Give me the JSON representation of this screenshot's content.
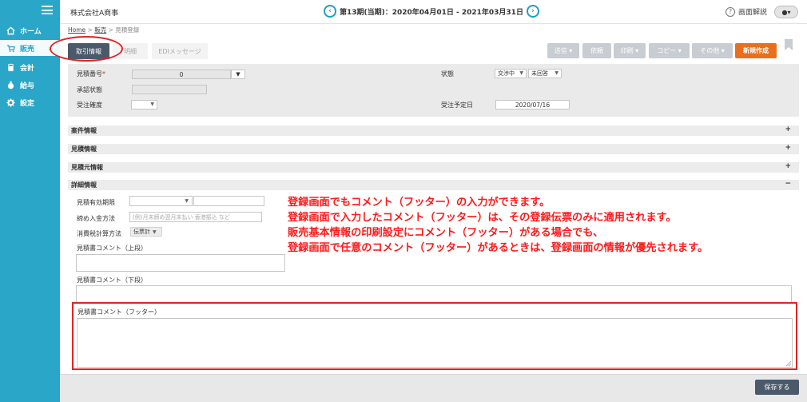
{
  "sidebar": {
    "items": [
      {
        "label": "ホーム",
        "icon": "home-icon"
      },
      {
        "label": "販売",
        "icon": "cart-icon"
      },
      {
        "label": "会計",
        "icon": "calculator-icon"
      },
      {
        "label": "給与",
        "icon": "money-bag-icon"
      },
      {
        "label": "設定",
        "icon": "gear-icon"
      }
    ]
  },
  "header": {
    "company": "株式会社A商事",
    "period": "第13期(当期)：2020年04月01日 - 2021年03月31日",
    "help_label": "画面解説"
  },
  "breadcrumb": {
    "home": "Home",
    "sales": "販売",
    "current": "見積登録"
  },
  "tabs": {
    "main": "取引情報",
    "detail": "明細",
    "edi": "EDIメッセージ"
  },
  "actions": {
    "send": "送信",
    "request": "依頼",
    "print": "印刷",
    "copy": "コピー",
    "other": "その他",
    "new": "新規作成"
  },
  "form": {
    "estimate_no_label": "見積番号",
    "estimate_no_value": "0",
    "approval_label": "承認状態",
    "accuracy_label": "受注確度",
    "status_label": "状態",
    "status_value1": "交渉中",
    "status_value2": "未回答",
    "expected_date_label": "受注予定日",
    "expected_date_value": "2020/07/16"
  },
  "sections": {
    "case": "案件情報",
    "estimate": "見積情報",
    "source": "見積元情報",
    "detail": "詳細情報",
    "plus": "+",
    "minus": "−"
  },
  "detail": {
    "validity_label": "見積有効期限",
    "payment_label": "締め入金方法",
    "payment_placeholder": "(例)月末締め翌月末払い 香港振込 など",
    "tax_label": "消費税計算方法",
    "tax_value": "伝票計",
    "comment_upper_label": "見積書コメント（上段）",
    "comment_lower_label": "見積書コメント（下段）",
    "comment_footer_label": "見積書コメント（フッター）"
  },
  "annotation": {
    "line1": "登録画面でもコメント（フッター）の入力ができます。",
    "line2": "登録画面で入力したコメント（フッター）は、その登録伝票のみに適用されます。",
    "line3": "販売基本情報の印刷設定にコメント（フッター）がある場合でも、",
    "line4": "登録画面で任意のコメント（フッター）があるときは、登録画面の情報が優先されます。"
  },
  "footer": {
    "save": "保存する"
  }
}
